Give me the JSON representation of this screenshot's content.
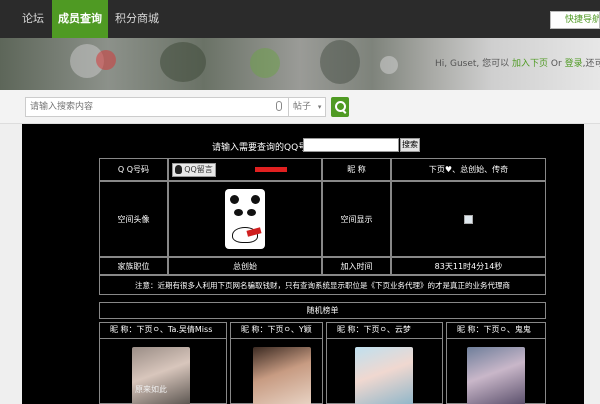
{
  "nav": {
    "items": [
      {
        "label": "论坛",
        "active": false
      },
      {
        "label": "成员查询",
        "active": true
      },
      {
        "label": "积分商城",
        "active": false
      }
    ],
    "quick_nav": "快捷导航"
  },
  "greeting": {
    "prefix": "Hi, Guset, 您可以",
    "join": "加入下页",
    "or": "Or",
    "login": "登录",
    "suffix": ",还可以"
  },
  "search": {
    "placeholder": "请输入搜索内容",
    "select_value": "帖子"
  },
  "query": {
    "label": "请输入需要查询的QQ号：",
    "button": "搜索"
  },
  "profile": {
    "qq_label": "Q Q号码",
    "qq_button": "QQ留言",
    "nickname_label": "昵 称",
    "nickname_value": "下页♥、总创始、传奇",
    "avatar_label": "空间头像",
    "space_label": "空间显示",
    "family_label": "家族职位",
    "family_value": "总创始",
    "join_label": "加入时间",
    "join_value": "83天11时4分14秒",
    "notice": "注意：近期有很多人利用下页网名骗取钱财，只有查询系统显示职位是《下页业务代理》的才是真正的业务代理商"
  },
  "ranking": {
    "title": "随机榜单",
    "members": [
      {
        "name": "昵 称：下页ㅇ、Ta.吴倩Miss",
        "photo": "young woman portrait",
        "caption": "原来如此"
      },
      {
        "name": "昵 称：下页ㅇ、Y颖",
        "photo": "young woman portrait",
        "caption": ""
      },
      {
        "name": "昵 称：下页ㅇ、云梦",
        "photo": "young woman portrait",
        "caption": ""
      },
      {
        "name": "昵 称：下页ㅇ、鬼鬼",
        "photo": "young woman portrait",
        "caption": ""
      }
    ]
  },
  "colors": {
    "brand_green": "#4f9a23",
    "panel_black": "#000000",
    "alert_red": "#e12020"
  },
  "icons": [
    "search-icon",
    "microphone-icon",
    "chevron-down-icon",
    "penguin-icon",
    "broken-image-icon"
  ]
}
